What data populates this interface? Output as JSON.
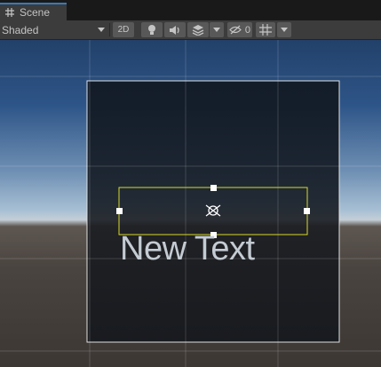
{
  "tab": {
    "label": "Scene"
  },
  "toolbar": {
    "shading_mode": "Shaded",
    "mode_2d_label": "2D",
    "hidden_count": "0"
  },
  "scene": {
    "text_object": "New Text"
  },
  "colors": {
    "selection_outline": "#d9d92a",
    "handle": "#ffffff",
    "canvas_border": "#e0e0e0"
  }
}
